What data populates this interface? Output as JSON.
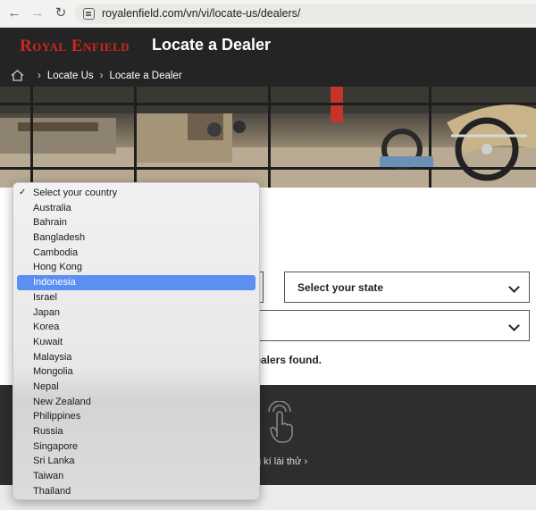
{
  "browser": {
    "url": "royalenfield.com/vn/vi/locate-us/dealers/"
  },
  "header": {
    "logo_text": "Royal Enfield",
    "page_title": "Locate a Dealer",
    "breadcrumb": [
      "Locate Us",
      "Locate a Dealer"
    ]
  },
  "filters": {
    "state_label": "Select your state",
    "result_text": "dealers found."
  },
  "footer": {
    "testride_text": "g kí lái thử  ›"
  },
  "country_dropdown": {
    "selected": "Select your country",
    "highlighted": "Indonesia",
    "options": [
      "Select your country",
      "Australia",
      "Bahrain",
      "Bangladesh",
      "Cambodia",
      "Hong Kong",
      "Indonesia",
      "Israel",
      "Japan",
      "Korea",
      "Kuwait",
      "Malaysia",
      "Mongolia",
      "Nepal",
      "New Zealand",
      "Philippines",
      "Russia",
      "Singapore",
      "Sri Lanka",
      "Taiwan",
      "Thailand"
    ]
  },
  "colors": {
    "header_bg": "#242424",
    "brand_red": "#d0271d",
    "highlight_blue": "#5d8ff2"
  }
}
